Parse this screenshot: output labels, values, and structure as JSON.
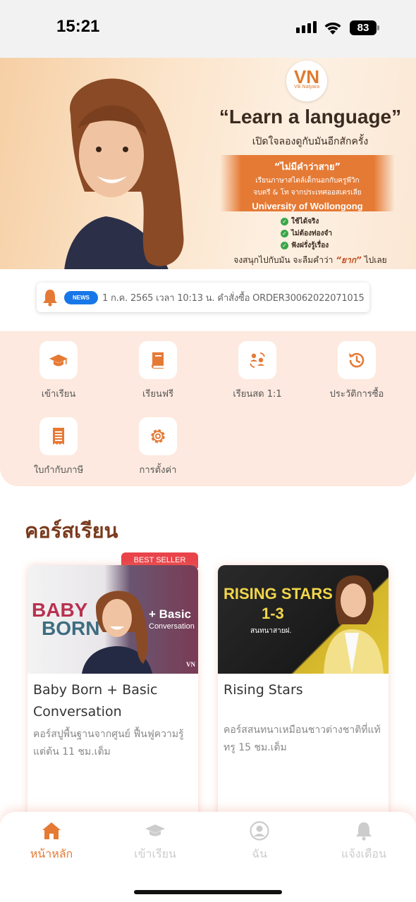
{
  "status": {
    "time": "15:21",
    "battery": "83"
  },
  "banner": {
    "logo_text": "VN",
    "logo_sub": "Vik Natyara",
    "headline": "“Learn a language”",
    "subline": "เปิดใจลองดูกับมันอีกสักครั้ง",
    "ribbon_title": "“ไม่มีคำว่าสาย”",
    "ribbon_line1": "เรียนภาษาสไตล์เด็กนอกกับครูพีวิก",
    "ribbon_line2": "จบตรี & โท จากประเทศออสเตรเลีย",
    "ribbon_uni": "University of Wollongong",
    "checks": [
      "ใช้ได้จริง",
      "ไม่ต้องท่องจำ",
      "ฟังฝรั่งรู้เรื่อง"
    ],
    "footer_pre": "จงสนุกไปกับมัน จะลืมคำว่า",
    "footer_em": "“ยาก”",
    "footer_post": "ไปเลย"
  },
  "news": {
    "badge": "NEWS",
    "text": "1 ก.ค. 2565 เวลา 10:13 น. คำสั่งซื้อ ORDER30062022071015"
  },
  "menu": {
    "items": [
      {
        "label": "เข้าเรียน",
        "icon": "graduation-cap-icon"
      },
      {
        "label": "เรียนฟรี",
        "icon": "book-icon"
      },
      {
        "label": "เรียนสด 1:1",
        "icon": "live-class-icon"
      },
      {
        "label": "ประวัติการซื้อ",
        "icon": "history-icon"
      },
      {
        "label": "ใบกำกับภาษี",
        "icon": "receipt-icon"
      },
      {
        "label": "การตั้งค่า",
        "icon": "gear-icon"
      }
    ]
  },
  "courses": {
    "title": "คอร์สเรียน",
    "badge": "BEST SELLER",
    "cards": [
      {
        "thumb_title_1": "BABY",
        "thumb_title_2": "BORN",
        "thumb_plus": "+ Basic",
        "thumb_sub": "Conversation",
        "thumb_logo": "VN",
        "title": "Baby Born + Basic Conversation",
        "desc": "คอร์สปูพื้นฐานจากศูนย์ ฟื้นฟูความรู้แต่ต้น 11 ชม.เต็ม"
      },
      {
        "thumb_title": "RISING STARS",
        "thumb_range": "1-3",
        "thumb_sub": "สนทนาสายฝ.",
        "title": "Rising Stars",
        "desc": "คอร์สสนทนาเหมือนชาวต่างชาติที่แท้ทรู 15 ชม.เต็ม"
      }
    ]
  },
  "tabs": [
    {
      "label": "หน้าหลัก",
      "icon": "home-icon",
      "active": true
    },
    {
      "label": "เข้าเรียน",
      "icon": "graduation-cap-icon",
      "active": false
    },
    {
      "label": "ฉัน",
      "icon": "user-icon",
      "active": false
    },
    {
      "label": "แจ้งเตือน",
      "icon": "bell-icon",
      "active": false
    }
  ],
  "colors": {
    "accent": "#e57a35",
    "menu_bg": "#fde9df",
    "news_badge": "#1877e8",
    "best_seller": "#e9444a",
    "title": "#7a3a1e"
  }
}
